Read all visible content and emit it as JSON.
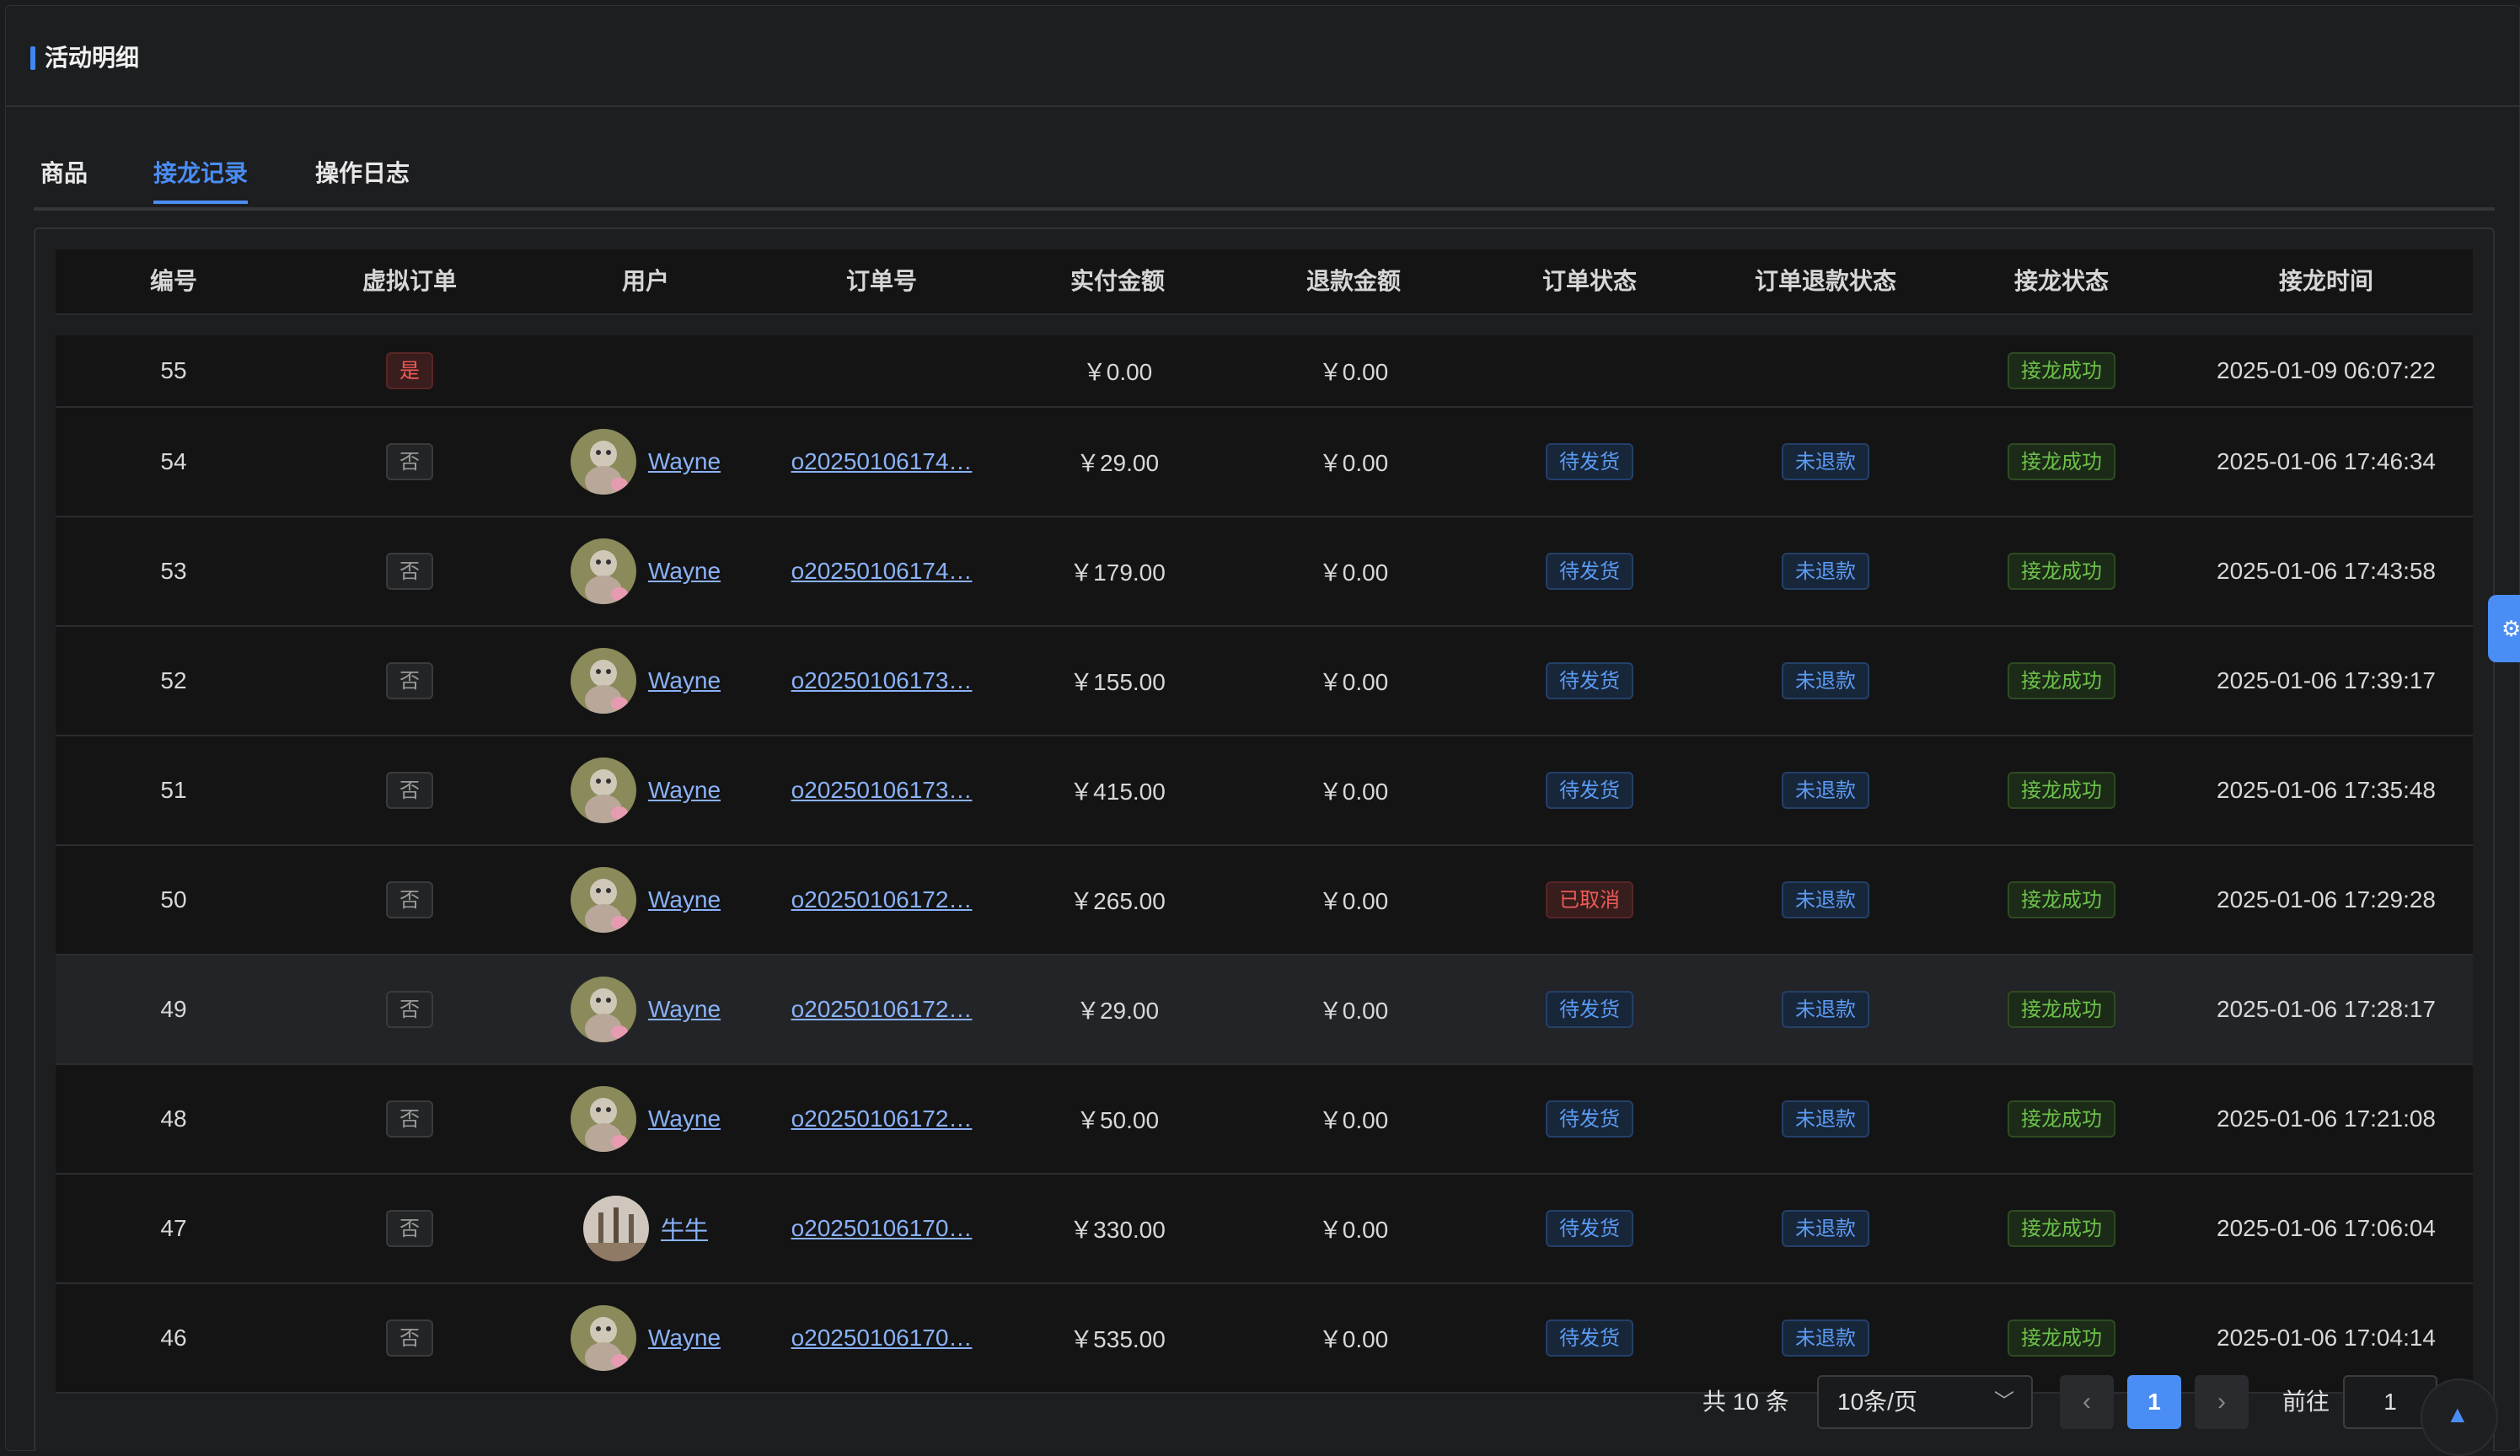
{
  "header": {
    "title": "活动明细"
  },
  "tabs": [
    {
      "label": "商品"
    },
    {
      "label": "接龙记录"
    },
    {
      "label": "操作日志"
    }
  ],
  "active_tab": "接龙记录",
  "table": {
    "columns": [
      "编号",
      "虚拟订单",
      "用户",
      "订单号",
      "实付金额",
      "退款金额",
      "订单状态",
      "订单退款状态",
      "接龙状态",
      "接龙时间"
    ],
    "rows": [
      {
        "id": "55",
        "virtual": "是",
        "user": "",
        "order": "",
        "paid": "￥0.00",
        "refund": "￥0.00",
        "order_status": "",
        "refund_status": "",
        "solitaire_status": "接龙成功",
        "time": "2025-01-09 06:07:22"
      },
      {
        "id": "54",
        "virtual": "否",
        "user": "Wayne",
        "order": "o20250106174…",
        "paid": "￥29.00",
        "refund": "￥0.00",
        "order_status": "待发货",
        "refund_status": "未退款",
        "solitaire_status": "接龙成功",
        "time": "2025-01-06 17:46:34"
      },
      {
        "id": "53",
        "virtual": "否",
        "user": "Wayne",
        "order": "o20250106174…",
        "paid": "￥179.00",
        "refund": "￥0.00",
        "order_status": "待发货",
        "refund_status": "未退款",
        "solitaire_status": "接龙成功",
        "time": "2025-01-06 17:43:58"
      },
      {
        "id": "52",
        "virtual": "否",
        "user": "Wayne",
        "order": "o20250106173…",
        "paid": "￥155.00",
        "refund": "￥0.00",
        "order_status": "待发货",
        "refund_status": "未退款",
        "solitaire_status": "接龙成功",
        "time": "2025-01-06 17:39:17"
      },
      {
        "id": "51",
        "virtual": "否",
        "user": "Wayne",
        "order": "o20250106173…",
        "paid": "￥415.00",
        "refund": "￥0.00",
        "order_status": "待发货",
        "refund_status": "未退款",
        "solitaire_status": "接龙成功",
        "time": "2025-01-06 17:35:48"
      },
      {
        "id": "50",
        "virtual": "否",
        "user": "Wayne",
        "order": "o20250106172…",
        "paid": "￥265.00",
        "refund": "￥0.00",
        "order_status": "已取消",
        "refund_status": "未退款",
        "solitaire_status": "接龙成功",
        "time": "2025-01-06 17:29:28"
      },
      {
        "id": "49",
        "virtual": "否",
        "user": "Wayne",
        "order": "o20250106172…",
        "paid": "￥29.00",
        "refund": "￥0.00",
        "order_status": "待发货",
        "refund_status": "未退款",
        "solitaire_status": "接龙成功",
        "time": "2025-01-06 17:28:17"
      },
      {
        "id": "48",
        "virtual": "否",
        "user": "Wayne",
        "order": "o20250106172…",
        "paid": "￥50.00",
        "refund": "￥0.00",
        "order_status": "待发货",
        "refund_status": "未退款",
        "solitaire_status": "接龙成功",
        "time": "2025-01-06 17:21:08"
      },
      {
        "id": "47",
        "virtual": "否",
        "user": "牛牛",
        "order": "o20250106170…",
        "paid": "￥330.00",
        "refund": "￥0.00",
        "order_status": "待发货",
        "refund_status": "未退款",
        "solitaire_status": "接龙成功",
        "time": "2025-01-06 17:06:04"
      },
      {
        "id": "46",
        "virtual": "否",
        "user": "Wayne",
        "order": "o20250106170…",
        "paid": "￥535.00",
        "refund": "￥0.00",
        "order_status": "待发货",
        "refund_status": "未退款",
        "solitaire_status": "接龙成功",
        "time": "2025-01-06 17:04:14"
      }
    ]
  },
  "pagination": {
    "total_label": "共 10 条",
    "page_size": "10条/页",
    "current_page": "1",
    "prev_icon": "chevron-left-icon",
    "next_icon": "chevron-right-icon",
    "goto_label": "前往",
    "goto_value": "1"
  },
  "colors": {
    "accent": "#4a8ef5",
    "background": "#1b1c1e"
  },
  "icons": {
    "side_tab": "gear-icon",
    "back_to_top": "caret-up-icon"
  }
}
